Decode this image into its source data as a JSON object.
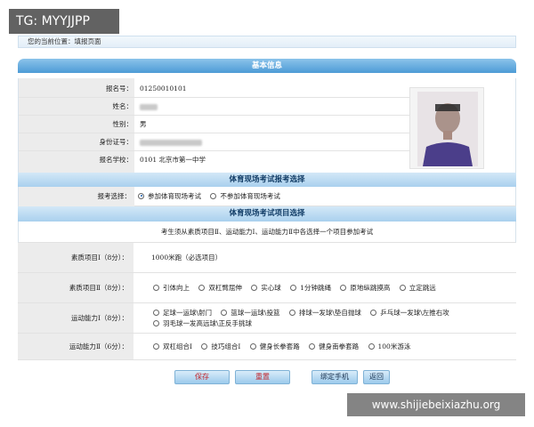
{
  "watermarks": {
    "top_left": "TG: MYYJJPP",
    "bottom_right": "www.shijiebeixiazhu.org"
  },
  "breadcrumb": "您的当前位置：填报页面",
  "basic_info": {
    "title": "基本信息",
    "fields": [
      {
        "label": "报名号：",
        "value": "01250010101"
      },
      {
        "label": "姓名：",
        "value": ""
      },
      {
        "label": "性别：",
        "value": "男"
      },
      {
        "label": "身份证号：",
        "value": ""
      },
      {
        "label": "报名学校：",
        "value": "0101  北京市第一中学"
      }
    ]
  },
  "exam_choice": {
    "title": "体育现场考试报考选择",
    "label": "报考选择：",
    "options": [
      "参加体育现场考试",
      "不参加体育现场考试"
    ],
    "selected": 0
  },
  "exam_items": {
    "title": "体育现场考试项目选择",
    "note": "考生须从素质项目Ⅱ、运动能力Ⅰ、运动能力Ⅱ中各选择一个项目参加考试",
    "sections": [
      {
        "label": "素质项目Ⅰ（8分）：",
        "fixed": "1000米跑（必选项目）"
      },
      {
        "label": "素质项目Ⅱ（8分）：",
        "options": [
          "引体向上",
          "双杠臂屈伸",
          "实心球",
          "1分钟跳绳",
          "原地纵跳摸高",
          "立定跳远"
        ]
      },
      {
        "label": "运动能力Ⅰ（8分）：",
        "options": [
          "足球一运球\\射门",
          "篮球一运球\\投篮",
          "排球一发球\\垫自抛球",
          "乒乓球一发球\\左推右攻",
          "羽毛球一发高远球\\正反手挑球"
        ]
      },
      {
        "label": "运动能力Ⅱ（6分）：",
        "options": [
          "双杠组合Ⅰ",
          "技巧组合Ⅰ",
          "健身长拳套路",
          "健身南拳套路",
          "100米游泳"
        ]
      }
    ]
  },
  "buttons": {
    "save": "保存",
    "reset": "重置",
    "bind_phone": "绑定手机",
    "back": "返回"
  }
}
